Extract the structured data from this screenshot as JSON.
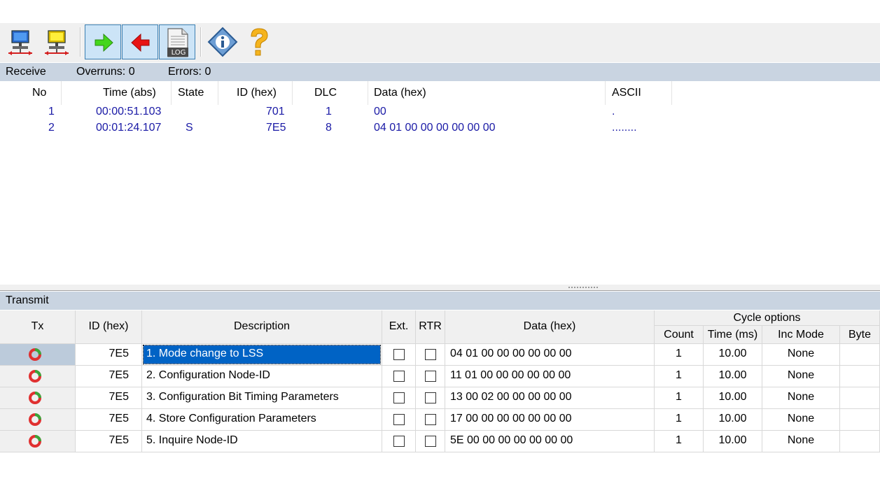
{
  "toolbar": {
    "buttons": [
      {
        "name": "connect-button",
        "icon": "network-connect-icon",
        "pressed": false
      },
      {
        "name": "disconnect-button",
        "icon": "network-disconnect-icon",
        "pressed": false
      },
      {
        "name": "receive-button",
        "icon": "arrow-right-icon",
        "pressed": true
      },
      {
        "name": "transmit-button",
        "icon": "arrow-left-icon",
        "pressed": true
      },
      {
        "name": "log-button",
        "icon": "log-file-icon",
        "pressed": true,
        "label": "LOG"
      },
      {
        "name": "info-button",
        "icon": "info-icon",
        "pressed": false
      },
      {
        "name": "help-button",
        "icon": "question-icon",
        "pressed": false
      }
    ]
  },
  "receive": {
    "title": "Receive",
    "overruns": "Overruns: 0",
    "errors": "Errors: 0",
    "columns": [
      "No",
      "Time (abs)",
      "State",
      "ID (hex)",
      "DLC",
      "Data (hex)",
      "ASCII"
    ],
    "rows": [
      {
        "no": "1",
        "time": "00:00:51.103",
        "state": "",
        "id": "701",
        "dlc": "1",
        "data": "00",
        "ascii": "."
      },
      {
        "no": "2",
        "time": "00:01:24.107",
        "state": "S",
        "id": "7E5",
        "dlc": "8",
        "data": "04 01 00 00 00 00 00 00",
        "ascii": "........"
      }
    ]
  },
  "transmit": {
    "title": "Transmit",
    "columns": {
      "tx": "Tx",
      "id": "ID (hex)",
      "description": "Description",
      "ext": "Ext.",
      "rtr": "RTR",
      "data": "Data (hex)",
      "cycle": "Cycle options",
      "count": "Count",
      "time": "Time (ms)",
      "inc_mode": "Inc Mode",
      "byte": "Byte"
    },
    "rows": [
      {
        "id": "7E5",
        "description": "1. Mode change to LSS",
        "ext": false,
        "rtr": false,
        "data": "04 01 00 00 00 00 00 00",
        "count": "1",
        "time": "10.00",
        "inc_mode": "None",
        "byte": "",
        "selected": true
      },
      {
        "id": "7E5",
        "description": "2. Configuration Node-ID",
        "ext": false,
        "rtr": false,
        "data": "11 01 00 00 00 00 00 00",
        "count": "1",
        "time": "10.00",
        "inc_mode": "None",
        "byte": "",
        "selected": false
      },
      {
        "id": "7E5",
        "description": "3. Configuration Bit Timing Parameters",
        "ext": false,
        "rtr": false,
        "data": "13 00 02 00 00 00 00 00",
        "count": "1",
        "time": "10.00",
        "inc_mode": "None",
        "byte": "",
        "selected": false
      },
      {
        "id": "7E5",
        "description": "4. Store Configuration Parameters",
        "ext": false,
        "rtr": false,
        "data": "17 00 00 00 00 00 00 00",
        "count": "1",
        "time": "10.00",
        "inc_mode": "None",
        "byte": "",
        "selected": false
      },
      {
        "id": "7E5",
        "description": "5. Inquire Node-ID",
        "ext": false,
        "rtr": false,
        "data": "5E 00 00 00 00 00 00 00",
        "count": "1",
        "time": "10.00",
        "inc_mode": "None",
        "byte": "",
        "selected": false
      }
    ]
  },
  "colors": {
    "section_bar": "#c9d4e1",
    "selection": "#0063c5",
    "rx_text": "#1a1aa6",
    "tx_icon_ring": "#e03030",
    "tx_icon_arc": "#3aa53a"
  }
}
